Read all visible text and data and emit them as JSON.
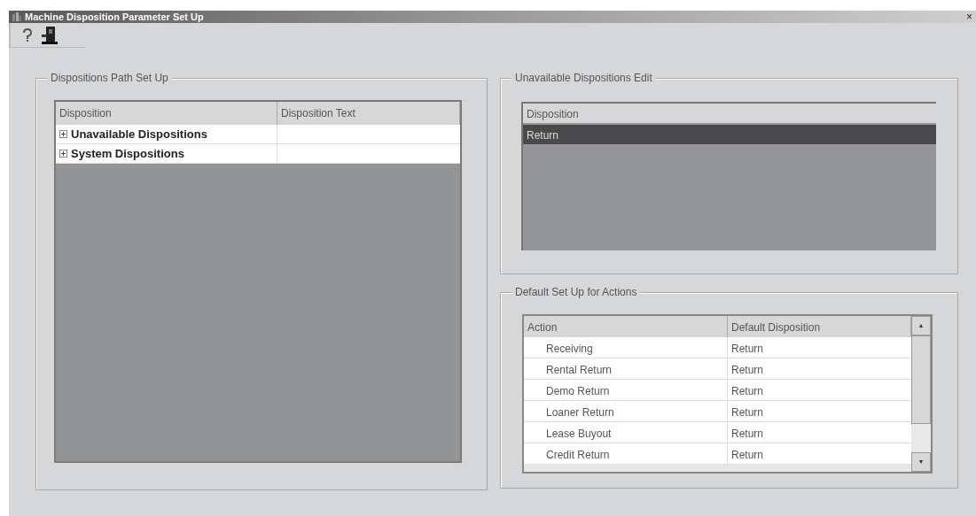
{
  "window": {
    "title": "Machine Disposition Parameter Set Up",
    "close": "×"
  },
  "paths": {
    "title": "Dispositions Path Set Up",
    "columns": [
      "Disposition",
      "Disposition Text"
    ],
    "rows": [
      {
        "label": "Unavailable Dispositions",
        "expanded": false
      },
      {
        "label": "System Dispositions",
        "expanded": false
      }
    ]
  },
  "unavailable": {
    "title": "Unavailable Dispositions Edit",
    "columns": [
      "Disposition"
    ],
    "rows": [
      {
        "label": "Return",
        "selected": true
      }
    ]
  },
  "defaults": {
    "title": "Default Set Up for Actions",
    "columns": [
      "Action",
      "Default Disposition"
    ],
    "rows": [
      {
        "action": "Receiving",
        "disposition": "Return"
      },
      {
        "action": "Rental Return",
        "disposition": "Return"
      },
      {
        "action": "Demo Return",
        "disposition": "Return"
      },
      {
        "action": "Loaner Return",
        "disposition": "Return"
      },
      {
        "action": "Lease Buyout",
        "disposition": "Return"
      },
      {
        "action": "Credit Return",
        "disposition": "Return"
      }
    ],
    "scroll_up": "▲",
    "scroll_down": "▼"
  }
}
